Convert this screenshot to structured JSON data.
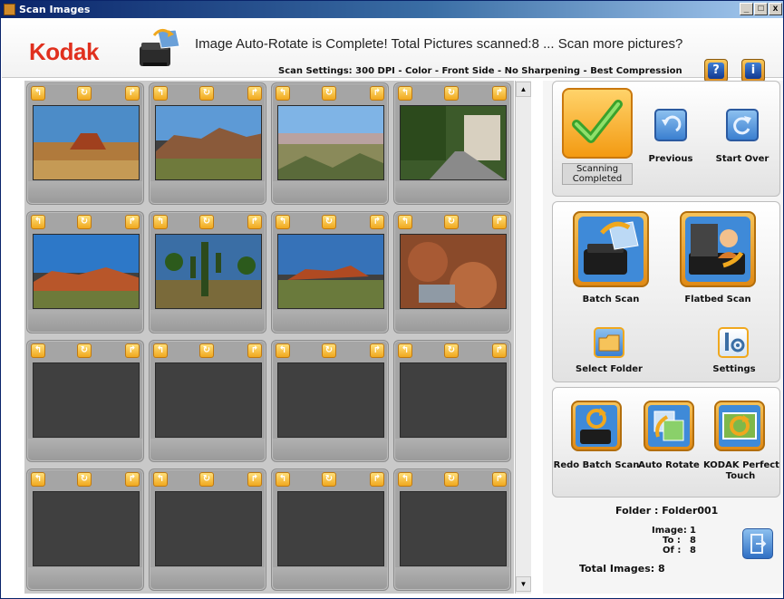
{
  "window": {
    "title": "Scan Images"
  },
  "header": {
    "logo": "Kodak",
    "status_message": "Image Auto-Rotate is Complete! Total Pictures scanned:8 ... Scan more pictures?",
    "scan_settings": "Scan Settings: 300 DPI - Color - Front Side - No Sharpening - Best Compression",
    "help_label": "?",
    "info_label": "i"
  },
  "grid": {
    "rows": [
      [
        "desert-butte",
        "desert-cliffs",
        "canyon-vista",
        "tree-lined-street"
      ],
      [
        "red-rocks",
        "saguaro-cactus",
        "red-rocks-plain",
        "red-boulders"
      ],
      [
        "empty",
        "empty",
        "empty",
        "empty"
      ],
      [
        "empty",
        "empty",
        "empty",
        "empty"
      ]
    ]
  },
  "panel": {
    "scanning_completed": "Scanning Completed",
    "previous": "Previous",
    "start_over": "Start Over",
    "batch_scan": "Batch Scan",
    "flatbed_scan": "Flatbed Scan",
    "select_folder": "Select Folder",
    "settings": "Settings",
    "redo_batch_scan": "Redo Batch Scan",
    "auto_rotate": "Auto Rotate",
    "perfect_touch_line1": "KODAK Perfect",
    "perfect_touch_line2": "Touch"
  },
  "info": {
    "folder": "Folder : Folder001",
    "image_label": "Image:",
    "image_value": "1",
    "to_label": "To :",
    "to_value": "8",
    "of_label": "Of :",
    "of_value": "8",
    "total": "Total Images: 8"
  },
  "colors": {
    "accent_orange": "#f0a81e",
    "kodak_red": "#e0301e",
    "icon_blue": "#1a4fa8"
  }
}
